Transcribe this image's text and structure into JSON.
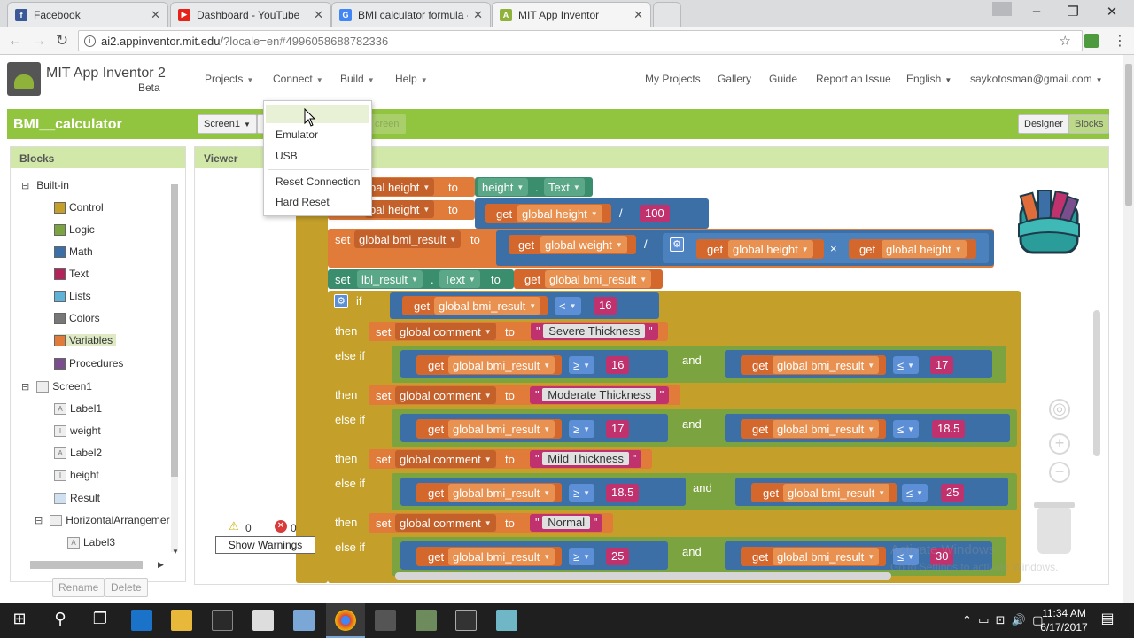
{
  "browser": {
    "tabs": [
      {
        "label": "Facebook",
        "color": "#3b5998",
        "glyph": "f"
      },
      {
        "label": "Dashboard - YouTube",
        "color": "#e62117",
        "glyph": "▶"
      },
      {
        "label": "BMI calculator formula -",
        "color": "#4285f4",
        "glyph": "G"
      },
      {
        "label": "MIT App Inventor",
        "color": "#8fb33a",
        "glyph": "A"
      }
    ],
    "url_host": "ai2.appinventor.mit.edu",
    "url_path": "/?locale=en#4996058688782336"
  },
  "header": {
    "title": "MIT App Inventor 2",
    "beta": "Beta",
    "menus": [
      "Projects",
      "Connect",
      "Build",
      "Help"
    ],
    "right_menus": [
      "My Projects",
      "Gallery",
      "Guide",
      "Report an Issue",
      "English",
      "saykotosman@gmail.com"
    ]
  },
  "project": {
    "name": "BMI__calculator",
    "screen_select": "Screen1",
    "add_screen": "creen",
    "designer": "Designer",
    "blocks": "Blocks"
  },
  "connect_menu": {
    "items": [
      "Emulator",
      "USB",
      "Reset Connection",
      "Hard Reset"
    ]
  },
  "blocks_panel": {
    "title": "Blocks",
    "builtin_label": "Built-in",
    "builtin": [
      {
        "label": "Control",
        "color": "#c4a02a"
      },
      {
        "label": "Logic",
        "color": "#7ba33f"
      },
      {
        "label": "Math",
        "color": "#3b6fa6"
      },
      {
        "label": "Text",
        "color": "#b3245a"
      },
      {
        "label": "Lists",
        "color": "#5fb3d9"
      },
      {
        "label": "Colors",
        "color": "#777777"
      },
      {
        "label": "Variables",
        "color": "#e07b39"
      },
      {
        "label": "Procedures",
        "color": "#7a4e8c"
      }
    ],
    "screen_label": "Screen1",
    "components": [
      "Label1",
      "weight",
      "Label2",
      "height",
      "Result",
      "HorizontalArrangemer",
      "Label3"
    ],
    "rename": "Rename",
    "delete": "Delete"
  },
  "viewer": {
    "title": "Viewer",
    "warnings_count": "0",
    "errors_count": "0",
    "show_warnings": "Show Warnings",
    "activate1": "Activate Windows",
    "activate2": "Go to Settings to activate Windows."
  },
  "code": {
    "row1": {
      "kw_to": "to",
      "var": "bal height",
      "comp": "height",
      "prop": "Text"
    },
    "row2": {
      "kw_to": "to",
      "var": "bal height",
      "get": "get",
      "getvar": "global height",
      "op": "/",
      "num": "100"
    },
    "row3": {
      "set": "set",
      "var": "global bmi_result",
      "kw_to": "to",
      "get": "get",
      "v1": "global weight",
      "op": "/",
      "v2": "global height",
      "times": "×",
      "v3": "global height"
    },
    "row4": {
      "set": "set",
      "comp": "lbl_result",
      "prop": "Text",
      "kw_to": "to",
      "get": "get",
      "v": "global bmi_result"
    },
    "if_kw": "if",
    "then_kw": "then",
    "elseif_kw": "else if",
    "and_kw": "and",
    "get_kw": "get",
    "set_kw": "set",
    "to_kw": "to",
    "bmi_var": "global bmi_result",
    "comment_var": "global comment",
    "conds": [
      {
        "op": "<",
        "val": "16"
      },
      {
        "op1": "≥",
        "val1": "16",
        "op2": "≤",
        "val2": "17"
      },
      {
        "op1": "≥",
        "val1": "17",
        "op2": "≤",
        "val2": "18.5"
      },
      {
        "op1": "≥",
        "val1": "18.5",
        "op2": "≤",
        "val2": "25"
      },
      {
        "op1": "≥",
        "val1": "25",
        "op2": "≤",
        "val2": "30"
      }
    ],
    "comments": [
      "Severe Thickness",
      "Moderate Thickness",
      "Mild Thickness",
      "Normal"
    ]
  },
  "taskbar": {
    "time": "11:34 AM",
    "date": "6/17/2017"
  },
  "colors": {
    "app_green": "#92c53f",
    "var_orange": "#e07b39",
    "get_orange": "#d3672c",
    "math_blue": "#3b6fa6",
    "control_gold": "#c4a02a",
    "logic_green": "#7ba33f",
    "text_pink": "#c0326e",
    "comp_teal": "#3b8e6d"
  }
}
